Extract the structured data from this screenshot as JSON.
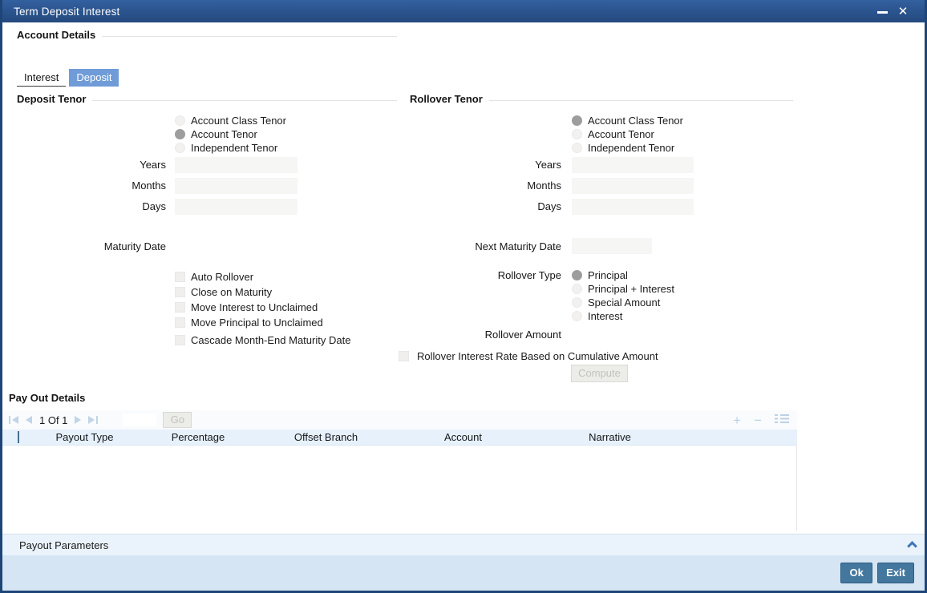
{
  "titlebar": {
    "title": "Term Deposit Interest"
  },
  "icons": {
    "minimize": "minimize-bar",
    "close": "✕",
    "add": "+",
    "remove": "−",
    "chevron_up": "chevron-up"
  },
  "account_details": {
    "heading": "Account Details"
  },
  "tabs": [
    {
      "label": "Interest",
      "active": false
    },
    {
      "label": "Deposit",
      "active": true
    }
  ],
  "deposit_tenor": {
    "heading": "Deposit Tenor",
    "tenor_options": [
      {
        "label": "Account Class Tenor",
        "selected": false
      },
      {
        "label": "Account Tenor",
        "selected": true
      },
      {
        "label": "Independent Tenor",
        "selected": false
      }
    ],
    "years_label": "Years",
    "years_value": "",
    "months_label": "Months",
    "months_value": "",
    "days_label": "Days",
    "days_value": "",
    "maturity_date_label": "Maturity Date",
    "maturity_date_value": "",
    "checkboxes": [
      {
        "label": "Auto Rollover",
        "checked": false
      },
      {
        "label": "Close on Maturity",
        "checked": false
      },
      {
        "label": "Move Interest to Unclaimed",
        "checked": false
      },
      {
        "label": "Move Principal to Unclaimed",
        "checked": false
      },
      {
        "label": "Cascade Month-End Maturity Date",
        "checked": false
      }
    ]
  },
  "rollover_tenor": {
    "heading": "Rollover Tenor",
    "tenor_options": [
      {
        "label": "Account Class Tenor",
        "selected": true
      },
      {
        "label": "Account Tenor",
        "selected": false
      },
      {
        "label": "Independent Tenor",
        "selected": false
      }
    ],
    "years_label": "Years",
    "years_value": "",
    "months_label": "Months",
    "months_value": "",
    "days_label": "Days",
    "days_value": "",
    "next_maturity_date_label": "Next Maturity Date",
    "next_maturity_date_value": "",
    "rollover_type_label": "Rollover Type",
    "rollover_type_options": [
      {
        "label": "Principal",
        "selected": true
      },
      {
        "label": "Principal + Interest",
        "selected": false
      },
      {
        "label": "Special Amount",
        "selected": false
      },
      {
        "label": "Interest",
        "selected": false
      }
    ],
    "rollover_amount_label": "Rollover Amount",
    "rollover_amount_value": "",
    "cumulative_checkbox_label": "Rollover Interest Rate Based on Cumulative Amount",
    "cumulative_checked": false,
    "compute_button": "Compute"
  },
  "pay_out_details": {
    "heading": "Pay Out Details",
    "pagination": {
      "page_indicator": "1 Of 1",
      "page_input_value": "",
      "go_button": "Go"
    },
    "columns": [
      "Payout Type",
      "Percentage",
      "Offset Branch",
      "Account",
      "Narrative"
    ],
    "rows": []
  },
  "payout_parameters": {
    "heading": "Payout Parameters"
  },
  "footer": {
    "ok_button": "Ok",
    "exit_button": "Exit"
  },
  "colors": {
    "titlebar_top": "#33609f",
    "titlebar_bottom": "#24497e",
    "window_border": "#1e4577",
    "tab_active_bg": "#6f9cd8",
    "grid_header_bg": "#e7f1fb",
    "params_bar_bg": "#eaf3fb",
    "footer_bg": "#d5e5f4",
    "action_button_bg": "#44779d",
    "chevron_accent": "#3e76b6"
  }
}
